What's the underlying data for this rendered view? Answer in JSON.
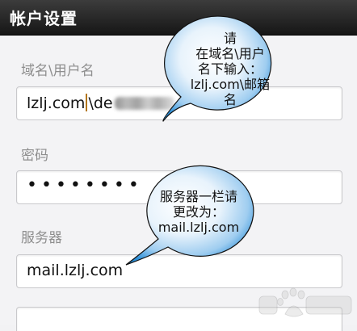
{
  "header": {
    "title": "帐户设置"
  },
  "form": {
    "username_label": "域名\\用户名",
    "username_value_before_cursor": "lzlj.com",
    "username_value_after_cursor": "\\de",
    "password_label": "密码",
    "password_value": "••••••••",
    "server_label": "服务器",
    "server_value": "mail.lzlj.com"
  },
  "callouts": {
    "top": {
      "lines": [
        "请",
        "在域名\\用户",
        "名下输入：",
        "lzlj.com\\邮箱",
        "名"
      ]
    },
    "bottom": {
      "lines": [
        "服务器一栏请",
        "更改为：",
        "mail.lzlj.com"
      ]
    }
  },
  "colors": {
    "bubble_fill": "#2a8ed8",
    "bubble_stroke": "#111111"
  },
  "icons": {
    "watermark": "baidu-paw-logo"
  }
}
